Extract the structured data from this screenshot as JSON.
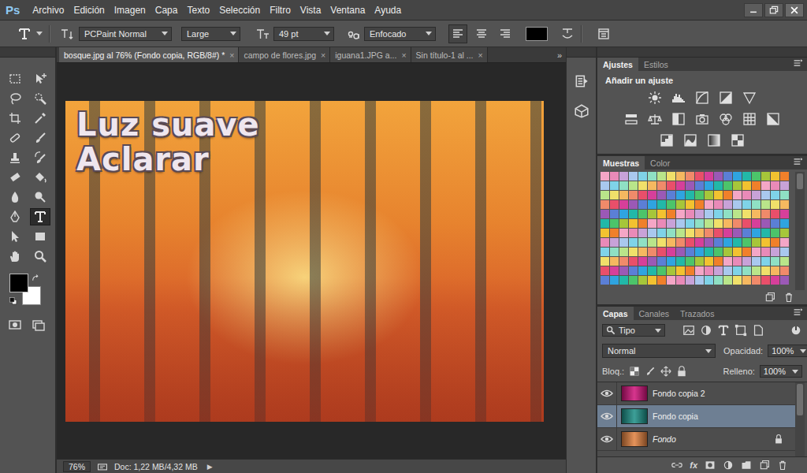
{
  "app": {
    "logo": "Ps"
  },
  "menu": [
    "Archivo",
    "Edición",
    "Imagen",
    "Capa",
    "Texto",
    "Selección",
    "Filtro",
    "Vista",
    "Ventana",
    "Ayuda"
  ],
  "options_bar": {
    "font_family": "PCPaint Normal",
    "font_style": "Large",
    "font_size": "49 pt",
    "antialias": "Enfocado",
    "alignment": [
      {
        "selected": true
      },
      {
        "selected": false
      },
      {
        "selected": false
      }
    ],
    "text_color": "#000000"
  },
  "document_tabs": [
    {
      "label": "bosque.jpg al 76% (Fondo copia, RGB/8#) *",
      "close": "×",
      "selected": true
    },
    {
      "label": "campo de flores.jpg",
      "close": "×",
      "selected": false
    },
    {
      "label": "iguana1.JPG a...",
      "close": "×",
      "selected": false
    },
    {
      "label": "Sin título-1 al ...",
      "close": "×",
      "selected": false
    }
  ],
  "tabs_overflow": "»",
  "tools": [
    {
      "selected": false
    },
    {
      "selected": false
    },
    {
      "selected": false
    },
    {
      "selected": false
    },
    {
      "selected": false
    },
    {
      "selected": false
    },
    {
      "selected": false
    },
    {
      "selected": false
    },
    {
      "selected": false
    },
    {
      "selected": false
    },
    {
      "selected": false
    },
    {
      "selected": false
    },
    {
      "selected": false
    },
    {
      "selected": false
    },
    {
      "selected": false
    },
    {
      "selected": true
    },
    {
      "selected": false
    },
    {
      "selected": false
    },
    {
      "selected": false
    },
    {
      "selected": false
    }
  ],
  "colors": {
    "foreground": "#000000",
    "background": "#ffffff"
  },
  "canvas": {
    "caption": [
      "Luz suave",
      "Aclarar"
    ]
  },
  "status_bar": {
    "zoom": "76%",
    "doc": "Doc: 1,22 MB/4,32 MB",
    "arrow": "▶"
  },
  "panels": {
    "adjustments": {
      "tabs": [
        {
          "label": "Ajustes",
          "selected": true
        },
        {
          "label": "Estilos",
          "selected": false
        }
      ],
      "heading": "Añadir un ajuste"
    },
    "swatches": {
      "tabs": [
        {
          "label": "Muestras",
          "selected": true
        },
        {
          "label": "Color",
          "selected": false
        }
      ],
      "rows": [
        [
          "#f4a6c6",
          "#e98ab8",
          "#c8a2d8",
          "#a9c8ee",
          "#7fd3e8",
          "#8fe0c4",
          "#b9e58a",
          "#f0e06a",
          "#f5b860",
          "#f08a6a",
          "#e94f6a",
          "#d63f9a",
          "#9b59b6",
          "#5b7fd6",
          "#2fa4e0",
          "#22b8a8",
          "#4cc46a",
          "#a6c63a",
          "#f2c230",
          "#f0802a"
        ],
        [
          "#a9c8ee",
          "#7fd3e8",
          "#8fe0c4",
          "#b9e58a",
          "#f0e06a",
          "#f5b860",
          "#f08a6a",
          "#e94f6a",
          "#d63f9a",
          "#9b59b6",
          "#5b7fd6",
          "#2fa4e0",
          "#22b8a8",
          "#4cc46a",
          "#a6c63a",
          "#f2c230",
          "#f0802a",
          "#f4a6c6",
          "#e98ab8",
          "#c8a2d8"
        ],
        [
          "#b9e58a",
          "#f0e06a",
          "#f5b860",
          "#f08a6a",
          "#e94f6a",
          "#d63f9a",
          "#9b59b6",
          "#5b7fd6",
          "#2fa4e0",
          "#22b8a8",
          "#4cc46a",
          "#a6c63a",
          "#f2c230",
          "#f0802a",
          "#f4a6c6",
          "#e98ab8",
          "#c8a2d8",
          "#a9c8ee",
          "#7fd3e8",
          "#8fe0c4"
        ],
        [
          "#f08a6a",
          "#e94f6a",
          "#d63f9a",
          "#9b59b6",
          "#5b7fd6",
          "#2fa4e0",
          "#22b8a8",
          "#4cc46a",
          "#a6c63a",
          "#f2c230",
          "#f0802a",
          "#f4a6c6",
          "#e98ab8",
          "#c8a2d8",
          "#a9c8ee",
          "#7fd3e8",
          "#8fe0c4",
          "#b9e58a",
          "#f0e06a",
          "#f5b860"
        ],
        [
          "#9b59b6",
          "#5b7fd6",
          "#2fa4e0",
          "#22b8a8",
          "#4cc46a",
          "#a6c63a",
          "#f2c230",
          "#f0802a",
          "#f4a6c6",
          "#e98ab8",
          "#c8a2d8",
          "#a9c8ee",
          "#7fd3e8",
          "#8fe0c4",
          "#b9e58a",
          "#f0e06a",
          "#f5b860",
          "#f08a6a",
          "#e94f6a",
          "#d63f9a"
        ],
        [
          "#22b8a8",
          "#4cc46a",
          "#a6c63a",
          "#f2c230",
          "#f0802a",
          "#f4a6c6",
          "#e98ab8",
          "#c8a2d8",
          "#a9c8ee",
          "#7fd3e8",
          "#8fe0c4",
          "#b9e58a",
          "#f0e06a",
          "#f5b860",
          "#f08a6a",
          "#e94f6a",
          "#d63f9a",
          "#9b59b6",
          "#5b7fd6",
          "#2fa4e0"
        ],
        [
          "#f2c230",
          "#f0802a",
          "#f4a6c6",
          "#e98ab8",
          "#c8a2d8",
          "#a9c8ee",
          "#7fd3e8",
          "#8fe0c4",
          "#b9e58a",
          "#f0e06a",
          "#f5b860",
          "#f08a6a",
          "#e94f6a",
          "#d63f9a",
          "#9b59b6",
          "#5b7fd6",
          "#2fa4e0",
          "#22b8a8",
          "#4cc46a",
          "#a6c63a"
        ],
        [
          "#e98ab8",
          "#c8a2d8",
          "#a9c8ee",
          "#7fd3e8",
          "#8fe0c4",
          "#b9e58a",
          "#f0e06a",
          "#f5b860",
          "#f08a6a",
          "#e94f6a",
          "#d63f9a",
          "#9b59b6",
          "#5b7fd6",
          "#2fa4e0",
          "#22b8a8",
          "#4cc46a",
          "#a6c63a",
          "#f2c230",
          "#f0802a",
          "#f4a6c6"
        ],
        [
          "#7fd3e8",
          "#8fe0c4",
          "#b9e58a",
          "#f0e06a",
          "#f5b860",
          "#f08a6a",
          "#e94f6a",
          "#d63f9a",
          "#9b59b6",
          "#5b7fd6",
          "#2fa4e0",
          "#22b8a8",
          "#4cc46a",
          "#a6c63a",
          "#f2c230",
          "#f0802a",
          "#f4a6c6",
          "#e98ab8",
          "#c8a2d8",
          "#a9c8ee"
        ],
        [
          "#f0e06a",
          "#f5b860",
          "#f08a6a",
          "#e94f6a",
          "#d63f9a",
          "#9b59b6",
          "#5b7fd6",
          "#2fa4e0",
          "#22b8a8",
          "#4cc46a",
          "#a6c63a",
          "#f2c230",
          "#f0802a",
          "#f4a6c6",
          "#e98ab8",
          "#c8a2d8",
          "#a9c8ee",
          "#7fd3e8",
          "#8fe0c4",
          "#b9e58a"
        ],
        [
          "#e94f6a",
          "#d63f9a",
          "#9b59b6",
          "#5b7fd6",
          "#2fa4e0",
          "#22b8a8",
          "#4cc46a",
          "#a6c63a",
          "#f2c230",
          "#f0802a",
          "#f4a6c6",
          "#e98ab8",
          "#c8a2d8",
          "#a9c8ee",
          "#7fd3e8",
          "#8fe0c4",
          "#b9e58a",
          "#f0e06a",
          "#f5b860",
          "#f08a6a"
        ],
        [
          "#5b7fd6",
          "#2fa4e0",
          "#22b8a8",
          "#4cc46a",
          "#a6c63a",
          "#f2c230",
          "#f0802a",
          "#f4a6c6",
          "#e98ab8",
          "#c8a2d8",
          "#a9c8ee",
          "#7fd3e8",
          "#8fe0c4",
          "#b9e58a",
          "#f0e06a",
          "#f5b860",
          "#f08a6a",
          "#e94f6a",
          "#d63f9a",
          "#9b59b6"
        ]
      ]
    },
    "layers": {
      "tabs": [
        {
          "label": "Capas",
          "selected": true
        },
        {
          "label": "Canales",
          "selected": false
        },
        {
          "label": "Trazados",
          "selected": false
        }
      ],
      "filter": "Tipo",
      "blend_mode": "Normal",
      "opacity_label": "Opacidad:",
      "opacity": "100%",
      "lock_label": "Bloq.:",
      "fill_label": "Relleno:",
      "fill": "100%",
      "items": [
        {
          "name": "Fondo copia 2",
          "visible": true,
          "selected": false,
          "locked": false,
          "color": "#d0127a"
        },
        {
          "name": "Fondo copia",
          "visible": true,
          "selected": true,
          "locked": false,
          "color": "#1b8f86"
        },
        {
          "name": "Fondo",
          "visible": true,
          "selected": false,
          "locked": true,
          "color": "#e0803e"
        }
      ],
      "fx": "fx"
    }
  }
}
